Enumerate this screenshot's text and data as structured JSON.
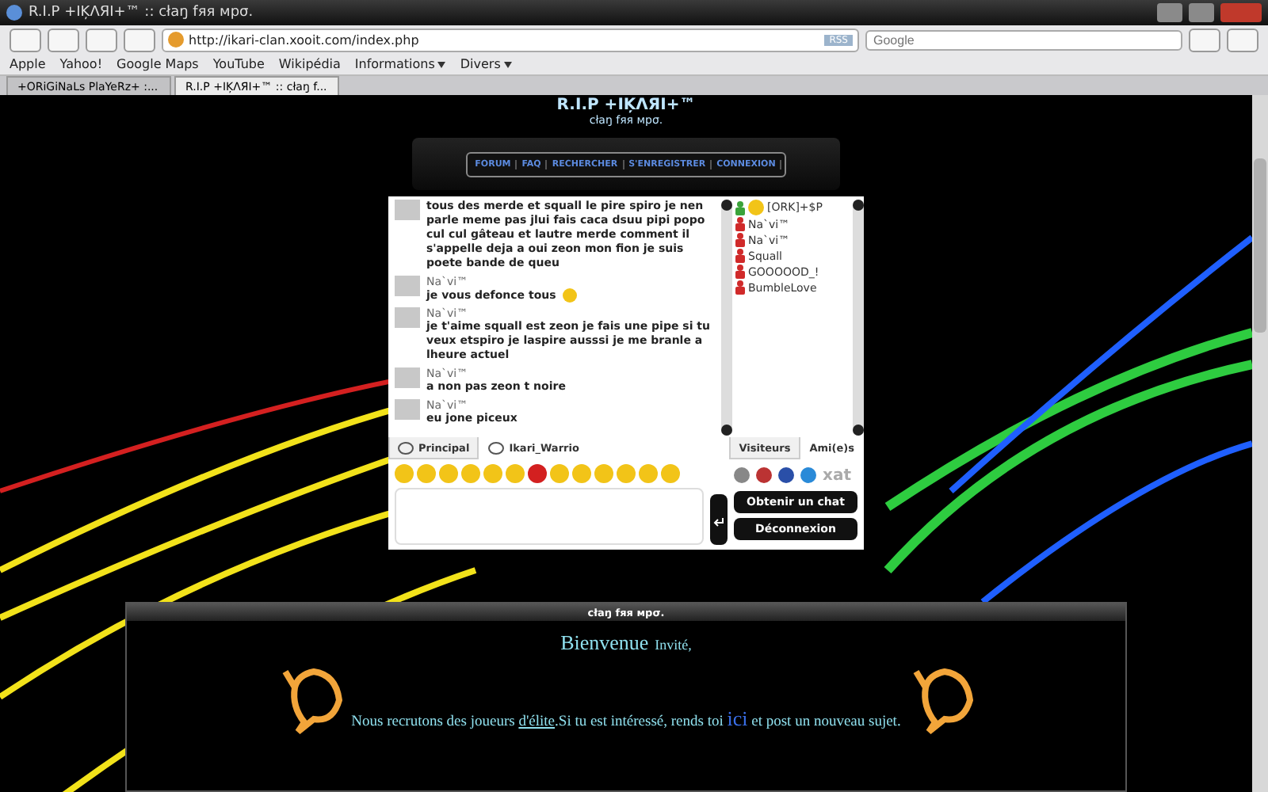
{
  "window": {
    "title": "R.I.P +IĶΛЯI+™ :: cłaŋ fяя мpσ."
  },
  "toolbar": {
    "address": "http://ikari-clan.xooit.com/index.php",
    "rss": "RSS",
    "search_placeholder": "Google"
  },
  "bookmarks": [
    {
      "label": "Apple",
      "kind": "link"
    },
    {
      "label": "Yahoo!",
      "kind": "link"
    },
    {
      "label": "Google Maps",
      "kind": "link"
    },
    {
      "label": "YouTube",
      "kind": "link"
    },
    {
      "label": "Wikipédia",
      "kind": "link"
    },
    {
      "label": "Informations",
      "kind": "menu"
    },
    {
      "label": "Divers",
      "kind": "menu"
    }
  ],
  "tabs": [
    {
      "label": "+ORiGiNaLs PlaYeRz+ :...",
      "selected": false
    },
    {
      "label": "R.I.P +IĶΛЯI+™ :: cłaŋ f...",
      "selected": true
    }
  ],
  "site": {
    "title": "R.I.P +IĶΛЯI+™",
    "subtitle": "cłaŋ fяя мpσ.",
    "nav": [
      "FORUM",
      "FAQ",
      "RECHERCHER",
      "S'ENREGISTRER",
      "CONNEXION"
    ]
  },
  "chat": {
    "messages": [
      {
        "text": "tous des merde et squall le pire spiro je nen parle meme pas jlui fais caca dsuu pipi popo cul cul gâteau et lautre merde comment il s'appelle deja a oui zeon mon fion je suis poete bande de queu",
        "emoji": false
      },
      {
        "author": "Na`vi™",
        "text": "je vous defonce tous",
        "emoji": true
      },
      {
        "author": "Na`vi™",
        "text": "je t'aime squall est zeon je fais une pipe si tu veux etspiro je laspire ausssi je me branle a lheure actuel",
        "emoji": false
      },
      {
        "author": "Na`vi™",
        "text": "a non pas zeon t noire",
        "emoji": false
      },
      {
        "author": "Na`vi™",
        "text": "eu jone piceux",
        "emoji": false
      }
    ],
    "tabs": [
      {
        "label": "Principal",
        "selected": true
      },
      {
        "label": "Ikari_Warrio",
        "selected": false
      }
    ],
    "users": [
      {
        "name": "[ORK]+$P",
        "kind": "owner"
      },
      {
        "name": "Na`vi™",
        "kind": "member"
      },
      {
        "name": "Na`vi™",
        "kind": "member"
      },
      {
        "name": "Squall",
        "kind": "member"
      },
      {
        "name": "GOOOOOD_!",
        "kind": "member"
      },
      {
        "name": "BumbleLove",
        "kind": "member"
      }
    ],
    "user_tabs": [
      {
        "label": "Visiteurs",
        "selected": true
      },
      {
        "label": "Ami(e)s",
        "selected": false
      }
    ],
    "get_chat": "Obtenir un chat",
    "logout": "Déconnexion",
    "brand": "xat"
  },
  "footer": {
    "header": "cłaŋ fяя мpσ.",
    "welcome": "Bienvenue",
    "guest": "Invité,",
    "sentence": {
      "before": "Nous recrutons des joueurs ",
      "link1": "d'élite",
      "middle": ".Si tu est intéressé, rends toi ",
      "link2": "ici",
      "after": " et post un nouveau sujet."
    }
  }
}
